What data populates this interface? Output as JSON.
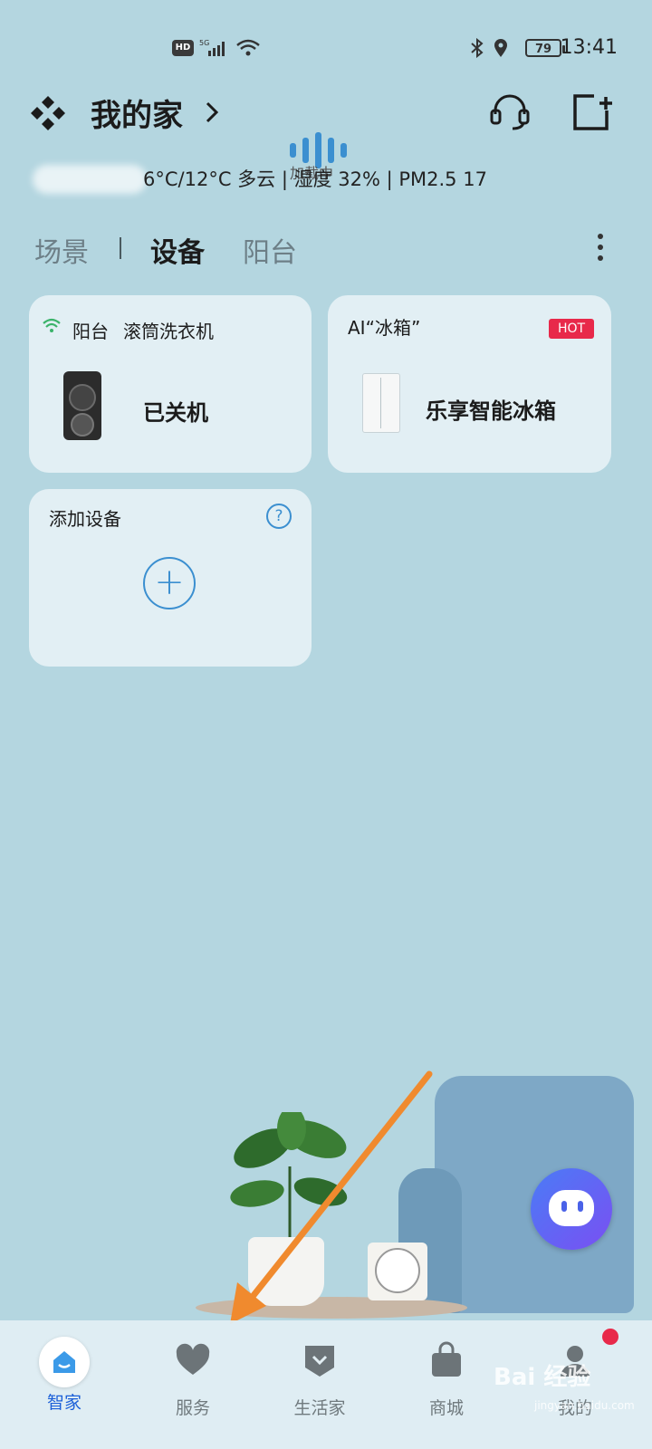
{
  "status_bar": {
    "hd": "HD",
    "network": "5G",
    "battery": "79",
    "time": "13:41"
  },
  "header": {
    "title": "我的家",
    "loading_text": "加载中",
    "weather": "6°C/12°C  多云 | 湿度 32% | PM2.5 17"
  },
  "tabs": [
    "场景",
    "设备",
    "阳台"
  ],
  "cards": {
    "washer": {
      "location": "阳台",
      "name": "滚筒洗衣机",
      "status": "已关机"
    },
    "fridge": {
      "label": "AI“冰箱”",
      "badge": "HOT",
      "name": "乐享智能冰箱"
    },
    "add": {
      "label": "添加设备",
      "plus": "+",
      "help": "?"
    }
  },
  "nav": {
    "items": [
      "智家",
      "服务",
      "生活家",
      "商城",
      "我的"
    ]
  },
  "watermark": {
    "main": "Bai 经验",
    "sub": "jingyan.baidu.com"
  },
  "colors": {
    "background": "#b4d6e0",
    "accent": "#3b8fd0",
    "active_nav": "#1b5fd8",
    "hot_badge": "#e8294a"
  }
}
